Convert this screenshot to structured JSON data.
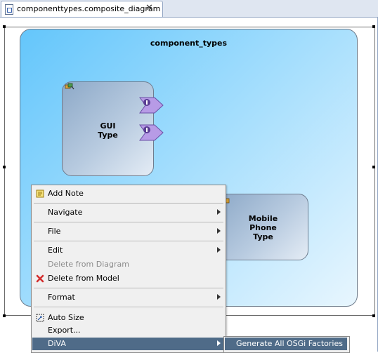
{
  "editor": {
    "tab_title": "componenttypes.composite_diagram",
    "tab_close": "✕"
  },
  "diagram": {
    "composite_name": "component_types",
    "components": [
      {
        "name_lines": [
          "GUI",
          "Type"
        ]
      },
      {
        "name_lines": [
          "Mobile",
          "Phone",
          "Type"
        ]
      }
    ]
  },
  "context_menu": {
    "items": [
      {
        "label": "Add Note",
        "icon": "note-icon"
      },
      {
        "label": "Navigate",
        "has_submenu": true
      },
      {
        "label": "File",
        "has_submenu": true
      },
      {
        "label": "Edit",
        "has_submenu": true
      },
      {
        "label": "Delete from Diagram",
        "enabled": false
      },
      {
        "label": "Delete from Model",
        "icon": "red-x-icon"
      },
      {
        "label": "Format",
        "has_submenu": true
      },
      {
        "label": "Auto Size",
        "icon": "auto-size-icon"
      },
      {
        "label": "Export..."
      },
      {
        "label": "DiVA",
        "has_submenu": true,
        "highlighted": true
      }
    ],
    "submenu": {
      "items": [
        {
          "label": "Generate All OSGi Factories",
          "highlighted": true
        }
      ]
    }
  },
  "colors": {
    "menu_highlight": "#4f6b88",
    "composite_gradient_start": "#64c6fb",
    "component_fill": "#8da9c8",
    "port_fill": "#b79be6",
    "delete_icon": "#d32f2f"
  }
}
